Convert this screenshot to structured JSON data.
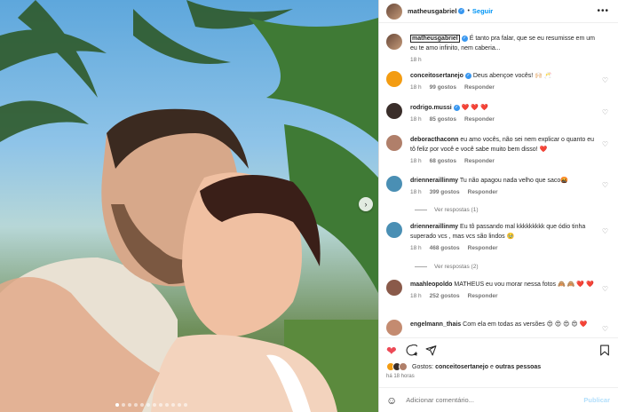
{
  "post": {
    "author": "matheusgabriel",
    "separator": "•",
    "follow_label": "Seguir",
    "more_label": "•••",
    "carousel_slides": 12,
    "carousel_active": 1
  },
  "caption": {
    "user": "matheusgabriel",
    "text": "É tanto pra falar, que se eu resumisse em um eu te amo infinito, nem caberia...",
    "time": "18 h"
  },
  "comments": [
    {
      "user": "conceitosertanejo",
      "verified": true,
      "text": "Deus abençoe vocês! 🙌🏻 🥂",
      "time": "18 h",
      "likes": "99 gostos",
      "reply": "Responder",
      "color": "#f39c12"
    },
    {
      "user": "rodrigo.mussi",
      "verified": true,
      "text": "❤️ ❤️ ❤️",
      "time": "18 h",
      "likes": "85 gostos",
      "reply": "Responder",
      "color": "#3a2e2a"
    },
    {
      "user": "deboracthaconn",
      "verified": false,
      "text": "eu amo vocês, não sei nem explicar o quanto eu tô feliz por você e você sabe muito bem disso! ❤️",
      "time": "18 h",
      "likes": "68 gostos",
      "reply": "Responder",
      "color": "#b07f6a"
    },
    {
      "user": "drienneraillinmy",
      "verified": false,
      "text": "Tu não apagou nada velho que saco🤬",
      "time": "18 h",
      "likes": "399 gostos",
      "reply": "Responder",
      "color": "#4a8fb4"
    },
    {
      "user": "drienneraillinmy",
      "verified": false,
      "text": "Eu tô passando mal kkkkkkkkk que ódio tinha superado vcs , mas vcs são lindos 🥹",
      "time": "18 h",
      "likes": "468 gostos",
      "reply": "Responder",
      "color": "#4a8fb4"
    },
    {
      "user": "maahleopoldo",
      "verified": false,
      "text": "MATHEUS eu vou morar nessa fotos 🙈 🙈 ❤️ ❤️",
      "time": "18 h",
      "likes": "252 gostos",
      "reply": "Responder",
      "color": "#8a5a4a"
    },
    {
      "user": "engelmann_thais",
      "verified": false,
      "text": "Com ela em todas as versões 😍 😍 😍 😍 ❤️",
      "time": "",
      "likes": "",
      "reply": "",
      "color": "#c48b70"
    }
  ],
  "reply_threads": [
    {
      "label": "Ver respostas (1)"
    },
    {
      "label": "Ver respostas (2)"
    }
  ],
  "likes": {
    "prefix": "Gostos:",
    "first": "conceitosertanejo",
    "joiner": "e",
    "rest": "outras pessoas"
  },
  "post_time": "há 18 horas",
  "composer": {
    "placeholder": "Adicionar comentário...",
    "publish": "Publicar"
  },
  "icons": {
    "like": "heart-filled-icon",
    "comment": "comment-icon",
    "share": "share-icon",
    "save": "bookmark-icon",
    "emoji": "emoji-icon"
  },
  "colors": {
    "accent": "#0095f6",
    "like_red": "#ed4956",
    "muted": "#737373"
  }
}
